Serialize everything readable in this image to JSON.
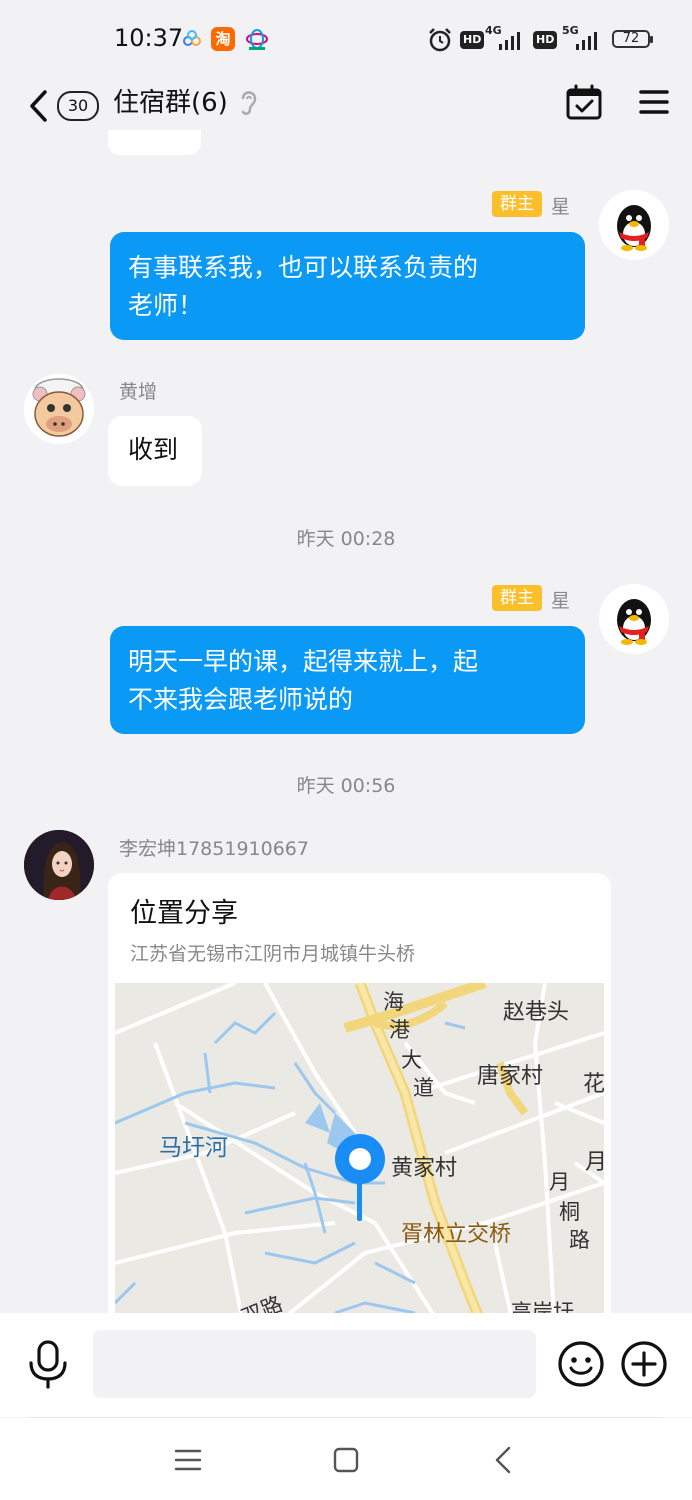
{
  "status_bar": {
    "time": "10:37",
    "app_taobao": "淘",
    "hd1": "HD",
    "net1": "4G",
    "hd2": "HD",
    "net2": "5G",
    "battery": "72"
  },
  "header": {
    "unread_count": "30",
    "group_title": "住宿群(6)"
  },
  "messages": [
    {
      "badge": "群主",
      "sender": "星",
      "text_line1": "有事联系我，也可以联系负责的",
      "text_line2": "老师！"
    },
    {
      "sender": "黄增",
      "text": "收到"
    },
    {
      "timestamp": "昨天 00:28"
    },
    {
      "badge": "群主",
      "sender": "星",
      "text_line1": "明天一早的课，起得来就上，起",
      "text_line2": "不来我会跟老师说的"
    },
    {
      "timestamp": "昨天 00:56"
    },
    {
      "sender": "李宏坤17851910667",
      "card_title": "位置分享",
      "card_address": "江苏省无锡市江阴市月城镇牛头桥"
    }
  ],
  "map_labels": {
    "road_main": "海港大道",
    "village1": "赵巷头",
    "village2": "唐家村",
    "village3": "花",
    "river": "马圩河",
    "village4": "黄家村",
    "village5": "月",
    "road2": "月桐路",
    "bridge": "胥林立交桥",
    "road3": "双路",
    "village6": "高岸圩"
  },
  "input": {
    "placeholder": ""
  },
  "icons": {
    "back": "chevron-left-icon",
    "ear": "ear-icon",
    "calendar": "calendar-check-icon",
    "menu": "hamburger-menu-icon",
    "mic": "microphone-icon",
    "emoji": "smiley-icon",
    "plus": "plus-circle-icon",
    "location_pin": "map-pin-icon"
  },
  "colors": {
    "bubble_blue": "#0a99f5",
    "badge_yellow": "#fcbf2c",
    "background": "#f2f2f4"
  }
}
